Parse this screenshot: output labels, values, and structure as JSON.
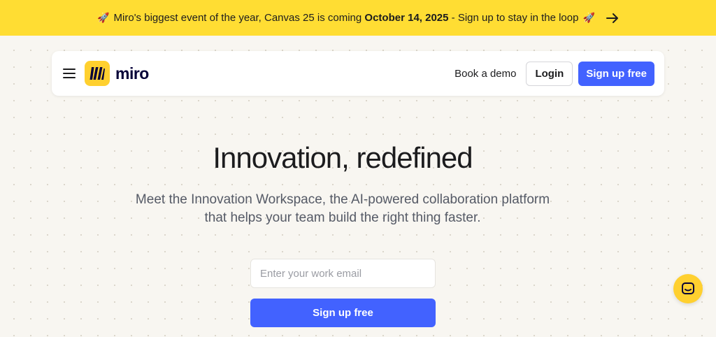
{
  "banner": {
    "rocket_left": "🚀",
    "text_before": "Miro's biggest event of the year, Canvas 25 is coming",
    "date": "October 14, 2025",
    "text_after": "- Sign up to stay in the loop",
    "rocket_right": "🚀",
    "arrow_icon": "arrow-right-icon",
    "color": "#ffdd33"
  },
  "nav": {
    "menu_icon": "hamburger-menu-icon",
    "logo_text": "miro",
    "logo_color": "#ffd02f",
    "book_demo": "Book a demo",
    "login": "Login",
    "signup": "Sign up free",
    "accent": "#4262ff"
  },
  "hero": {
    "title": "Innovation, redefined",
    "subtitle_line1": "Meet the Innovation Workspace, the AI-powered collaboration platform",
    "subtitle_line2": "that helps your team build the right thing faster."
  },
  "form": {
    "email_placeholder": "Enter your work email",
    "email_value": "",
    "submit": "Sign up free"
  },
  "chat": {
    "icon": "chat-icon"
  }
}
